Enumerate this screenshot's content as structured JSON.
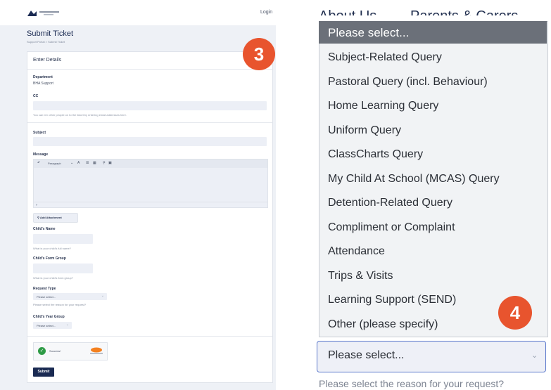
{
  "left": {
    "header": {
      "login": "Login"
    },
    "page_title": "Submit Ticket",
    "breadcrumb": "Support Portal > Submit Ticket",
    "card_title": "Enter Details",
    "department": {
      "label": "Department",
      "value": "BHA Support"
    },
    "cc": {
      "label": "CC",
      "hint": "You can CC other people on to the ticket by entering email addresses here."
    },
    "subject": {
      "label": "Subject"
    },
    "message": {
      "label": "Message",
      "toolbar_format": "Paragraph",
      "footer": "p"
    },
    "attachment_button": "Add Attachment",
    "child_name": {
      "label": "Child's Name",
      "hint": "What is your child's full name?"
    },
    "form_group": {
      "label": "Child's Form Group",
      "hint": "What is your child's form group?"
    },
    "request_type": {
      "label": "Request Type",
      "placeholder": "Please select...",
      "hint": "Please select the reason for your request?"
    },
    "year_group": {
      "label": "Child's Year Group",
      "placeholder": "Please select..."
    },
    "captcha": {
      "status": "Success!"
    },
    "submit_button": "Submit",
    "badge": "3"
  },
  "right": {
    "nav": {
      "about": "About Us",
      "parents": "Parents & Carers"
    },
    "dropdown": {
      "selected": "Please select...",
      "options": [
        "Subject-Related Query",
        "Pastoral Query (incl. Behaviour)",
        "Home Learning Query",
        "Uniform Query",
        "ClassCharts Query",
        "My Child At School (MCAS) Query",
        "Detention-Related Query",
        "Compliment or Complaint",
        "Attendance",
        "Trips & Visits",
        "Learning Support (SEND)",
        "Other (please specify)"
      ]
    },
    "select_value": "Please select...",
    "hint": "Please select the reason for your request?",
    "badge": "4"
  },
  "colors": {
    "accent": "#e8542e",
    "dropdown_header": "#6b7079",
    "focus_border": "#5b78cc",
    "submit": "#1a2a52"
  }
}
